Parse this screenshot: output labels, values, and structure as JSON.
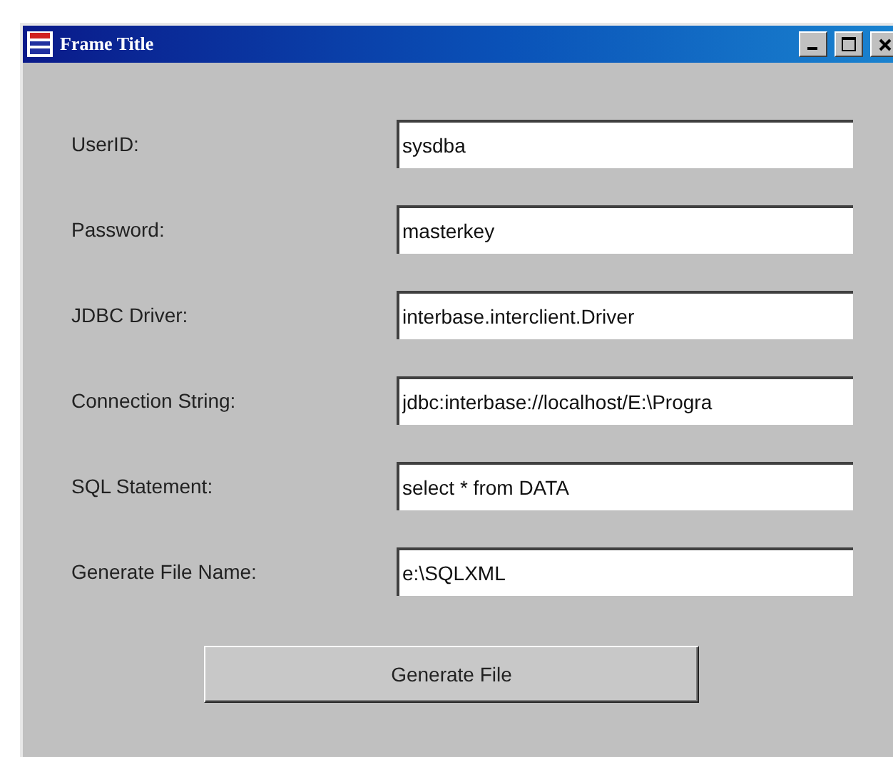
{
  "window": {
    "title": "Frame Title"
  },
  "fields": [
    {
      "label": "UserID:",
      "value": "sysdba"
    },
    {
      "label": "Password:",
      "value": "masterkey"
    },
    {
      "label": "JDBC Driver:",
      "value": "interbase.interclient.Driver"
    },
    {
      "label": "Connection String:",
      "value": "jdbc:interbase://localhost/E:\\Progra"
    },
    {
      "label": "SQL Statement:",
      "value": "select * from DATA"
    },
    {
      "label": "Generate File Name:",
      "value": "e:\\SQLXML"
    }
  ],
  "buttons": [
    "Generate File"
  ]
}
